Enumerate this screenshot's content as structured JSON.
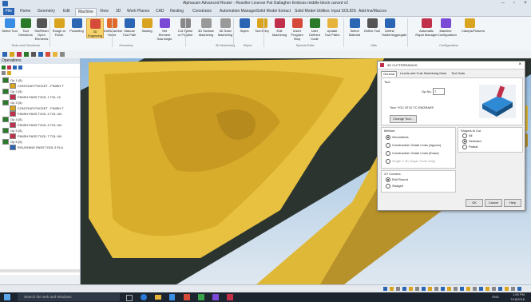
{
  "window": {
    "title": "Alphacam Advanced Router - Reseller License Pat Gallagher Emboss middle block carved v2"
  },
  "menu": {
    "tabs": [
      "File",
      "Home",
      "Geometry",
      "Edit",
      "Machine",
      "View",
      "3D",
      "Work Planes",
      "CAD",
      "Nesting",
      "Constrains",
      "Automation Manager",
      "Solid Model Extract",
      "Solid Model Utilities",
      "Input SOLIDS",
      "Add-Ins/Macros"
    ],
    "active": "Machine"
  },
  "ribbon": {
    "buttons": [
      {
        "label": "Select Tool",
        "icon": "select-tool-icon"
      },
      {
        "label": "Tool Directions",
        "icon": "tool-directions-icon"
      },
      {
        "label": "Set/Reset Open Elements",
        "icon": "open-elements-icon"
      },
      {
        "label": "Rough or Finish",
        "icon": "rough-finish-icon"
      },
      {
        "label": "Pocketing",
        "icon": "pocketing-icon"
      },
      {
        "label": "3D Engraving",
        "icon": "engraving-icon"
      },
      {
        "label": "Drill/Machine Holes",
        "icon": "drill-icon"
      },
      {
        "label": "Manual Tool Path",
        "icon": "manual-path-icon"
      },
      {
        "label": "Sawing",
        "icon": "sawing-icon"
      },
      {
        "label": "Set Element Saw Angle",
        "icon": "saw-angle-icon"
      },
      {
        "label": "Cut Spline or Polyline",
        "icon": "spline-icon"
      },
      {
        "label": "3D Surface Machining",
        "icon": "surface-icon"
      },
      {
        "label": "3D Solid Machining",
        "icon": "solid-icon"
      },
      {
        "label": "Styles",
        "icon": "styles-icon"
      },
      {
        "label": "Tool Entry",
        "icon": "tool-entry-icon"
      },
      {
        "label": "Edit Machining",
        "icon": "edit-machining-icon"
      },
      {
        "label": "Insert Program Stop",
        "icon": "program-stop-icon"
      },
      {
        "label": "User Defined Code",
        "icon": "user-code-icon"
      },
      {
        "label": "Update Tool Paths",
        "icon": "update-paths-icon"
      },
      {
        "label": "Select Material",
        "icon": "material-icon"
      },
      {
        "label": "Define Tool",
        "icon": "define-tool-icon"
      },
      {
        "label": "Define Holder/Aggregate",
        "icon": "holder-icon"
      },
      {
        "label": "Automatic Rapid Manager",
        "icon": "rapid-icon"
      },
      {
        "label": "Machine Configuration",
        "icon": "machine-config-icon"
      },
      {
        "label": "Clamps/Fixtures",
        "icon": "clamps-icon"
      }
    ],
    "groups": [
      "Tools and Directions",
      "Geometry",
      "3D Machining",
      "Styles",
      "Special Edits",
      "Utils",
      "Configuration"
    ]
  },
  "operations": {
    "title": "Operations",
    "rows": [
      {
        "text": "Op 1 (5)",
        "color": "#2a7a2a"
      },
      {
        "text": "CONTOUR POCKET - FINISH T",
        "color": "#d9a520"
      },
      {
        "text": "Op 2 (5)",
        "color": "#2a7a2a"
      },
      {
        "text": "FINISH PASS  TOOL 1  TOL 12",
        "color": "#c0304a"
      },
      {
        "text": "Op 3 (5)",
        "color": "#2a7a2a"
      },
      {
        "text": "CONTOUR POCKET - FINISH T",
        "color": "#d9a520"
      },
      {
        "text": "FINISH PASS  TOOL 4  TOL UN",
        "color": "#c0304a"
      },
      {
        "text": "Op 4 (5)",
        "color": "#2a7a2a"
      },
      {
        "text": "FINISH PASS  TOOL 4  TOL UN",
        "color": "#c0304a"
      },
      {
        "text": "Op 5 (5)",
        "color": "#2a7a2a"
      },
      {
        "text": "FINISH PASS  TOOL 7  TOL UN",
        "color": "#c0304a"
      },
      {
        "text": "Op 6 (5)",
        "color": "#2a7a2a"
      },
      {
        "text": "ROUGHING PASS  TOOL 5  FLA",
        "color": "#2b66b5"
      }
    ]
  },
  "dialog": {
    "title": "3D CUTTERRADIUS",
    "tabs": [
      "General",
      "Levels and Cuts",
      "Machining Data",
      "Tool Data"
    ],
    "tool_section": "Tool",
    "op_no_label": "Op No.",
    "op_no_value": "7",
    "tool_name": "Tool: YGC 8T10 TC ENGRAVE",
    "change_tool": "Change Tool...",
    "method_section": "Method",
    "methods": [
      "Geometries",
      "Construction Guide Lines (Approx)",
      "Construction Guide Lines (Exact)",
      "Single Z 3D (Taper Tools Only)"
    ],
    "method_selected": 0,
    "shapes_section": "Shapes to Cut",
    "shapes": [
      "All",
      "Selected",
      "Partial"
    ],
    "shape_selected": 1,
    "corners_section": "XY Corners",
    "corners": [
      "Roll Round",
      "Straight"
    ],
    "corner_selected": 0,
    "ok": "OK",
    "cancel": "Cancel",
    "help": "Help"
  },
  "taskbar": {
    "search_placeholder": "Search the web and Windows",
    "time": "1:55 PM",
    "date": "7/18/2016",
    "lang": "ENG"
  },
  "colors": {
    "accent": "#2b66b5",
    "carving": "#e7c13f",
    "selected_ribbon": "#f6d36b"
  }
}
